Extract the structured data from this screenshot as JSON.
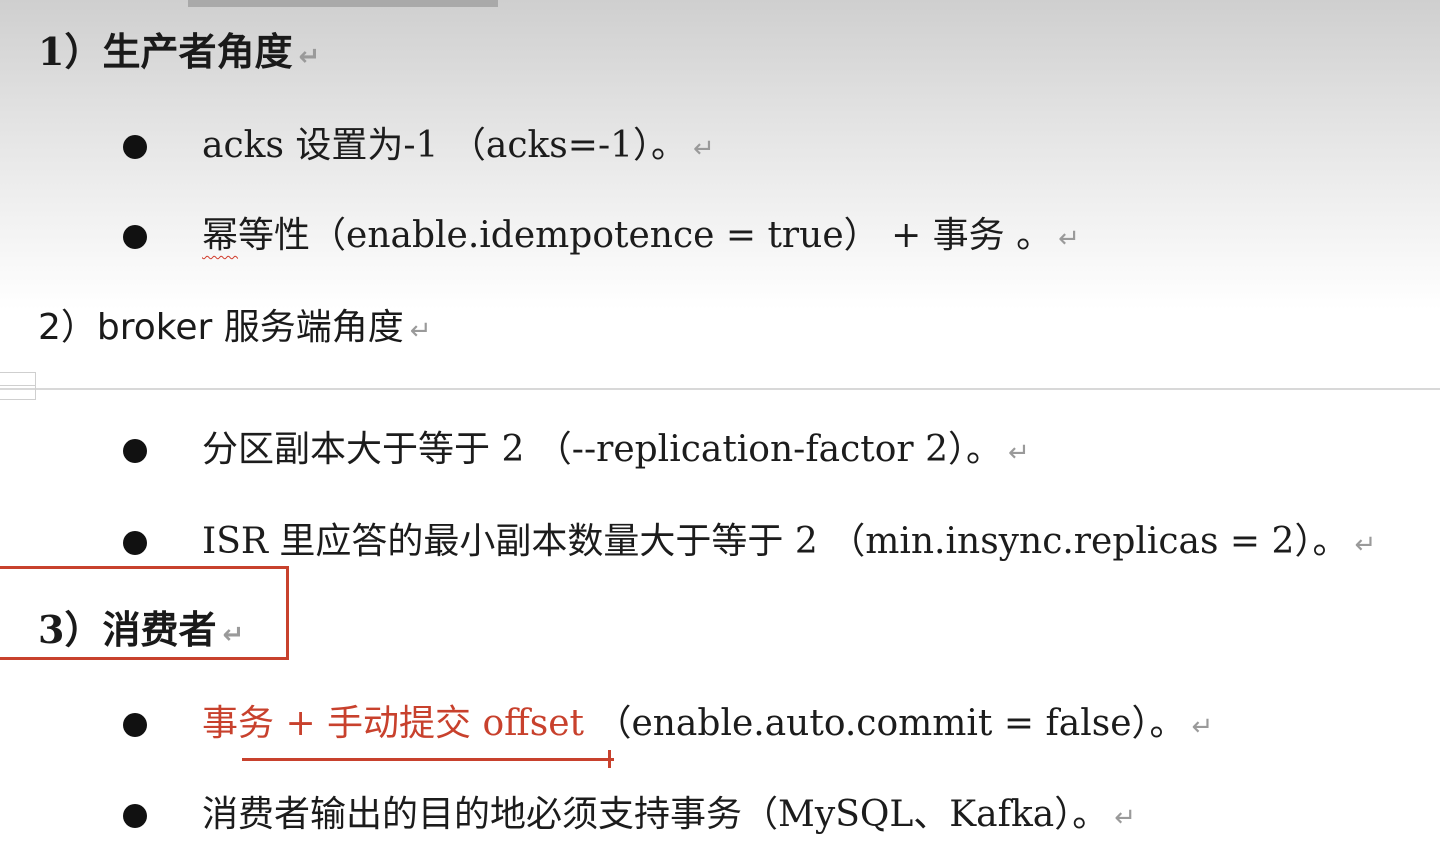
{
  "document": {
    "return_mark": "↵",
    "bullet_char": "",
    "sections": [
      {
        "heading": "1）生产者角度",
        "items": [
          {
            "text": "acks 设置为-1 （acks=-1）。"
          },
          {
            "text_prefix": "幂",
            "text": "等性（enable.idempotence = true） + 事务 。"
          }
        ]
      },
      {
        "heading": "2）broker 服务端角度",
        "items": [
          {
            "text": "分区副本大于等于 2 （--replication-factor 2）。"
          },
          {
            "text": "ISR 里应答的最小副本数量大于等于 2 （min.insync.replicas = 2）。"
          }
        ]
      },
      {
        "heading": "3）消费者",
        "items": [
          {
            "text_red": "事务 + 手动提交 offset",
            "text": " （enable.auto.commit = false）。"
          },
          {
            "text": "消费者输出的目的地必须支持事务（MySQL、Kafka）。"
          }
        ]
      }
    ]
  },
  "colors": {
    "accent_red": "#c8412d",
    "text": "#1c1c1c"
  }
}
